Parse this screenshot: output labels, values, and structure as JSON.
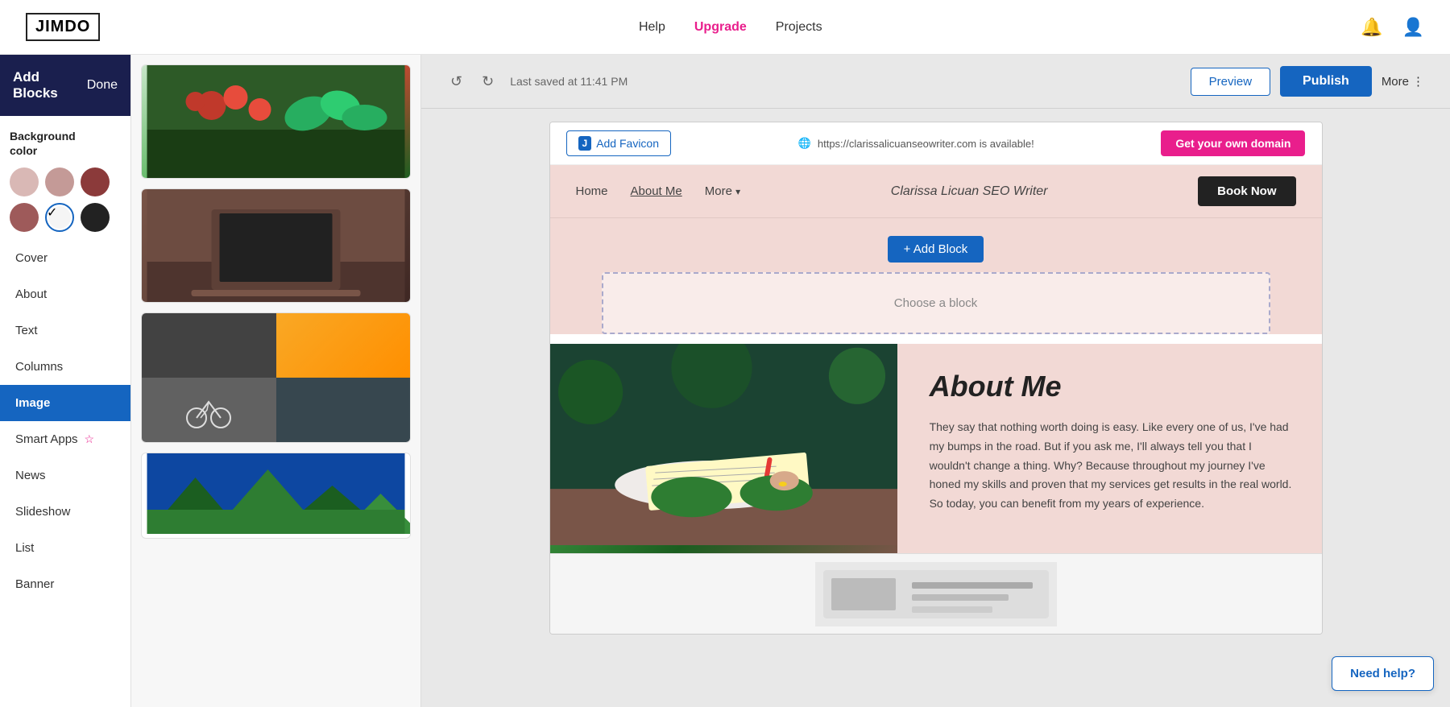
{
  "topnav": {
    "logo": "JIMDO",
    "links": [
      {
        "label": "Help",
        "id": "help"
      },
      {
        "label": "Upgrade",
        "id": "upgrade",
        "class": "upgrade"
      },
      {
        "label": "Projects",
        "id": "projects"
      }
    ]
  },
  "sidebar": {
    "header": "Add Blocks",
    "done_label": "Done",
    "background_color_label": "Background\ncolor",
    "swatches": [
      {
        "color": "#d9b8b5",
        "selected": false
      },
      {
        "color": "#c49a97",
        "selected": false
      },
      {
        "color": "#8b3a3a",
        "selected": false
      },
      {
        "color": "#9e5a5a",
        "selected": false
      },
      {
        "color": "#ffffff",
        "selected": true
      },
      {
        "color": "#222222",
        "selected": false
      }
    ],
    "items": [
      {
        "label": "Cover",
        "id": "cover",
        "active": false
      },
      {
        "label": "About",
        "id": "about",
        "active": false
      },
      {
        "label": "Text",
        "id": "text",
        "active": false
      },
      {
        "label": "Columns",
        "id": "columns",
        "active": false
      },
      {
        "label": "Image",
        "id": "image",
        "active": true
      },
      {
        "label": "Smart Apps",
        "id": "smart-apps",
        "active": false,
        "has_star": true
      },
      {
        "label": "News",
        "id": "news",
        "active": false
      },
      {
        "label": "Slideshow",
        "id": "slideshow",
        "active": false
      },
      {
        "label": "List",
        "id": "list",
        "active": false
      },
      {
        "label": "Banner",
        "id": "banner",
        "active": false
      }
    ]
  },
  "editor": {
    "undo_label": "↺",
    "redo_label": "↻",
    "saved_text": "Last saved at 11:41 PM",
    "preview_label": "Preview",
    "publish_label": "Publish",
    "more_label": "More"
  },
  "favicon_bar": {
    "add_favicon_label": "Add Favicon",
    "domain_prefix": "https://",
    "domain": "clarissalicuanseowriter.com",
    "domain_suffix": " is available!",
    "get_domain_label": "Get your own domain"
  },
  "site_nav": {
    "links": [
      {
        "label": "Home",
        "id": "home"
      },
      {
        "label": "About Me",
        "id": "about-me",
        "active": true
      },
      {
        "label": "More",
        "id": "more",
        "has_dropdown": true
      }
    ],
    "title": "Clarissa Licuan SEO Writer",
    "book_label": "Book Now"
  },
  "add_block": {
    "button_label": "+ Add Block",
    "choose_label": "Choose a block"
  },
  "about_section": {
    "title": "About Me",
    "body": "They say that nothing worth doing is easy. Like every one of us, I've had my bumps in the road. But if you ask me, I'll always tell you that I wouldn't change a thing. Why? Because throughout my journey I've honed my skills and proven that my services get results in the real world. So today, you can benefit from my years of experience."
  },
  "need_help": {
    "label": "Need help?"
  }
}
